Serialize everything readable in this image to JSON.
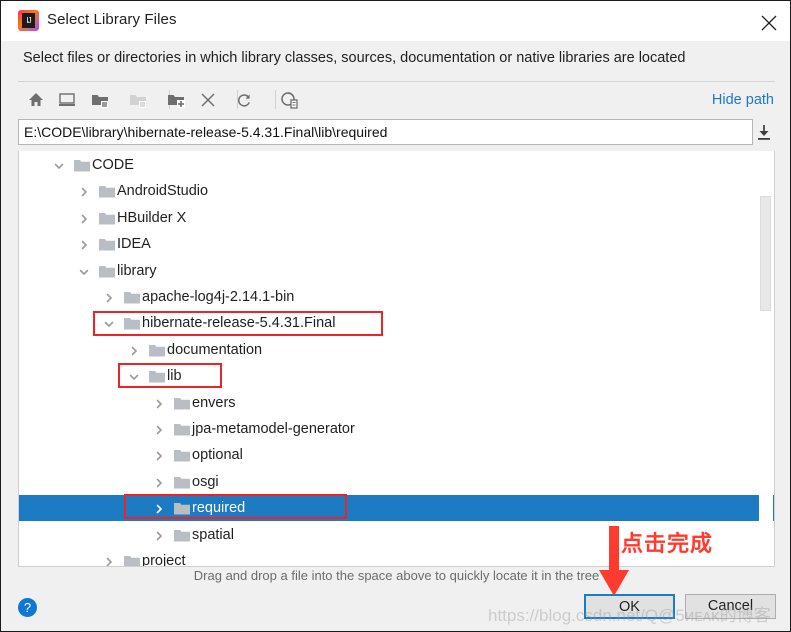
{
  "window": {
    "title": "Select Library Files",
    "app_icon": "intellij-idea-logo",
    "close_icon": "close-icon",
    "description": "Select files or directories in which library classes, sources, documentation or native libraries are located"
  },
  "toolbar": {
    "buttons": [
      {
        "name": "home-icon",
        "title": "Home"
      },
      {
        "name": "desktop-icon",
        "title": "Desktop"
      },
      {
        "name": "folder-open-icon",
        "title": "Project Directory"
      },
      {
        "name": "folder-disabled-icon",
        "title": "Module Directory"
      },
      {
        "name": "new-folder-icon",
        "title": "New Folder"
      },
      {
        "name": "delete-icon",
        "title": "Delete"
      },
      {
        "name": "refresh-icon",
        "title": "Refresh"
      },
      {
        "name": "show-hidden-icon",
        "title": "Show Hidden Files and Directories"
      }
    ],
    "hide_path_label": "Hide path"
  },
  "path": {
    "value": "E:\\CODE\\library\\hibernate-release-5.4.31.Final\\lib\\required",
    "placeholder": "",
    "download_icon": "download-arrow-icon"
  },
  "tree": {
    "rows": [
      {
        "label": "CODE",
        "depth": 0,
        "expanded": true,
        "selected": false
      },
      {
        "label": "AndroidStudio",
        "depth": 1,
        "expanded": false,
        "selected": false
      },
      {
        "label": "HBuilder X",
        "depth": 1,
        "expanded": false,
        "selected": false
      },
      {
        "label": "IDEA",
        "depth": 1,
        "expanded": false,
        "selected": false
      },
      {
        "label": "library",
        "depth": 1,
        "expanded": true,
        "selected": false
      },
      {
        "label": "apache-log4j-2.14.1-bin",
        "depth": 2,
        "expanded": false,
        "selected": false
      },
      {
        "label": "hibernate-release-5.4.31.Final",
        "depth": 2,
        "expanded": true,
        "selected": false
      },
      {
        "label": "documentation",
        "depth": 3,
        "expanded": false,
        "selected": false
      },
      {
        "label": "lib",
        "depth": 3,
        "expanded": true,
        "selected": false
      },
      {
        "label": "envers",
        "depth": 4,
        "expanded": false,
        "selected": false
      },
      {
        "label": "jpa-metamodel-generator",
        "depth": 4,
        "expanded": false,
        "selected": false
      },
      {
        "label": "optional",
        "depth": 4,
        "expanded": false,
        "selected": false
      },
      {
        "label": "osgi",
        "depth": 4,
        "expanded": false,
        "selected": false
      },
      {
        "label": "required",
        "depth": 4,
        "expanded": false,
        "selected": true
      },
      {
        "label": "spatial",
        "depth": 4,
        "expanded": false,
        "selected": false
      },
      {
        "label": "project",
        "depth": 2,
        "expanded": false,
        "selected": false
      }
    ],
    "selected_label": "required",
    "selection_color": "#1d7bc4"
  },
  "footer": {
    "hint": "Drag and drop a file into the space above to quickly locate it in the tree",
    "help_icon": "question-mark-icon",
    "ok_label": "OK",
    "cancel_label": "Cancel"
  },
  "annotations": {
    "text": "点击完成",
    "color": "#ff3b30",
    "arrow_icon": "down-arrow-icon",
    "highlight_boxes": [
      "hibernate-release-5.4.31.Final",
      "lib",
      "required"
    ]
  },
  "watermark": {
    "text": "https://blog.csdn.net/Q@5ᴎᴇᴀᴋ的博客"
  }
}
